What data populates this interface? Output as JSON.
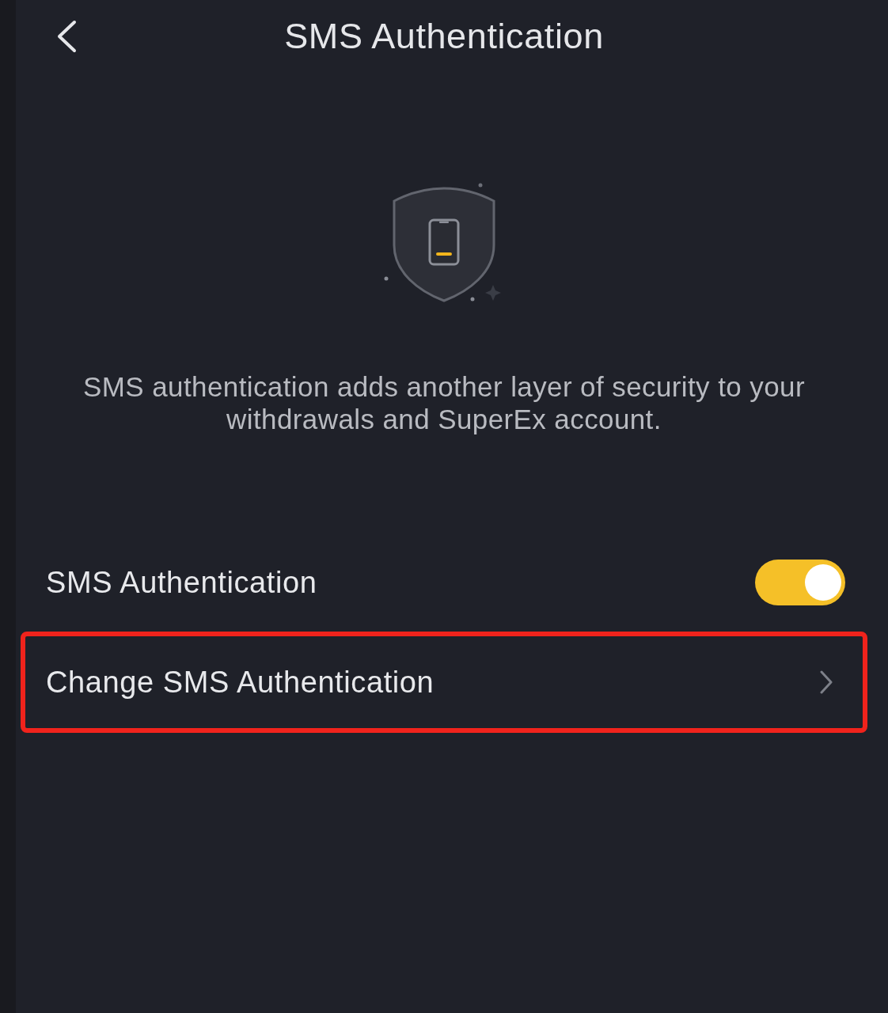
{
  "header": {
    "title": "SMS Authentication"
  },
  "description": "SMS authentication adds another layer of security to your withdrawals and SuperEx account.",
  "settings": [
    {
      "kind": "toggle",
      "label": "SMS Authentication",
      "on": true
    },
    {
      "kind": "link",
      "label": "Change SMS Authentication",
      "highlighted": true
    }
  ]
}
